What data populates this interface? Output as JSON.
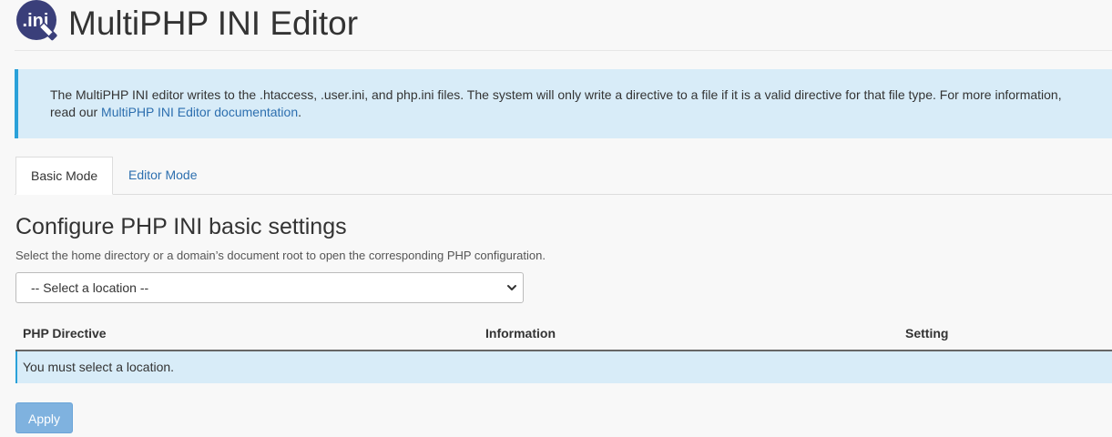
{
  "header": {
    "logo_text": ".ini",
    "title": "MultiPHP INI Editor"
  },
  "callout": {
    "text_before_link": "The MultiPHP INI editor writes to the .htaccess, .user.ini, and php.ini files. The system will only write a directive to a file if it is a valid directive for that file type. For more information,",
    "text_line2_prefix": "read our ",
    "link_text": "MultiPHP INI Editor documentation",
    "text_after_link": "."
  },
  "tabs": [
    {
      "label": "Basic Mode",
      "active": true
    },
    {
      "label": "Editor Mode",
      "active": false
    }
  ],
  "section": {
    "title": "Configure PHP INI basic settings",
    "description": "Select the home directory or a domain’s document root to open the corresponding PHP configuration."
  },
  "location_select": {
    "selected": "-- Select a location --"
  },
  "table": {
    "columns": [
      "PHP Directive",
      "Information",
      "Setting"
    ],
    "empty_message": "You must select a location."
  },
  "apply_button": {
    "label": "Apply"
  },
  "colors": {
    "accent": "#2aa1d9",
    "link": "#2d6faf",
    "info_bg": "#d8ecf8",
    "button_bg": "#7fb2df",
    "logo_bg": "#3a3f7a"
  }
}
